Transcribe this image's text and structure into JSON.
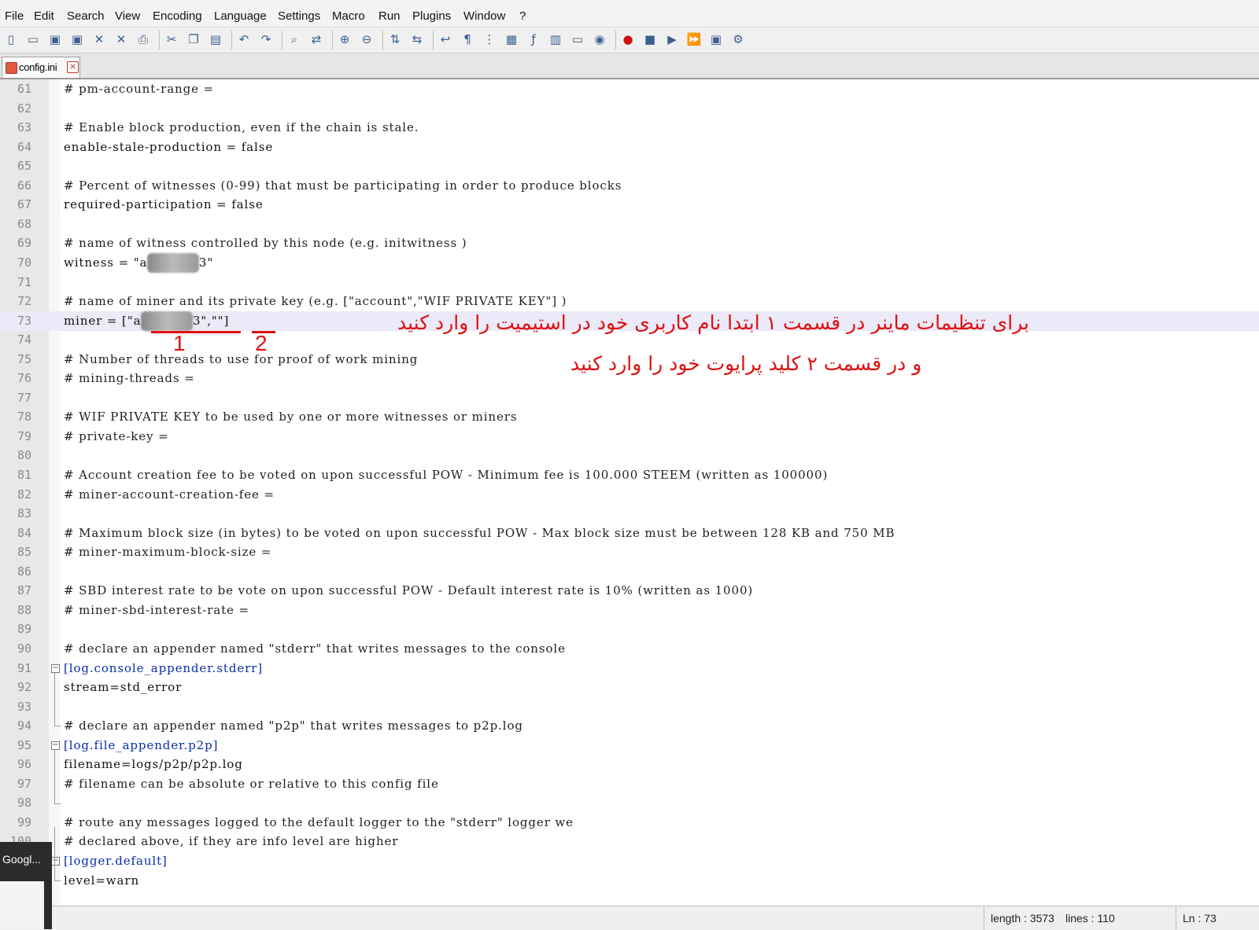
{
  "menu": [
    "File",
    "Edit",
    "Search",
    "View",
    "Encoding",
    "Language",
    "Settings",
    "Macro",
    "Run",
    "Plugins",
    "Window",
    "?"
  ],
  "toolbar_icons": [
    "new-file-icon",
    "open-file-icon",
    "save-icon",
    "save-all-icon",
    "close-icon",
    "close-all-icon",
    "print-icon",
    "cut-icon",
    "copy-icon",
    "paste-icon",
    "undo-icon",
    "redo-icon",
    "find-icon",
    "replace-icon",
    "zoom-in-icon",
    "zoom-out-icon",
    "sync-vertical-icon",
    "sync-horizontal-icon",
    "word-wrap-icon",
    "show-all-chars-icon",
    "indent-guide-icon",
    "doc-map-icon",
    "function-list-icon",
    "folder-workspace-icon",
    "monitor-icon",
    "eye-icon",
    "record-macro-icon",
    "stop-macro-icon",
    "play-macro-icon",
    "run-macro-multiple-icon",
    "save-macro-icon",
    "plugin-icon"
  ],
  "tab": {
    "label": "config.ini"
  },
  "editor": {
    "lines": [
      {
        "n": "61",
        "text": "# pm-account-range =",
        "kind": "comment"
      },
      {
        "n": "62",
        "text": "",
        "kind": "blank"
      },
      {
        "n": "63",
        "text": "# Enable block production, even if the chain is stale.",
        "kind": "comment"
      },
      {
        "n": "64",
        "text": "enable-stale-production = false",
        "kind": "code"
      },
      {
        "n": "65",
        "text": "",
        "kind": "blank"
      },
      {
        "n": "66",
        "text": "# Percent of witnesses (0-99) that must be participating in order to produce blocks",
        "kind": "comment"
      },
      {
        "n": "67",
        "text": "required-participation = false",
        "kind": "code"
      },
      {
        "n": "68",
        "text": "",
        "kind": "blank"
      },
      {
        "n": "69",
        "text": "# name of witness controlled by this node (e.g. initwitness )",
        "kind": "comment"
      },
      {
        "n": "70",
        "text": "witness = \"a▇▇▇▇▇▇▇3\"",
        "kind": "code"
      },
      {
        "n": "71",
        "text": "",
        "kind": "blank"
      },
      {
        "n": "72",
        "text": "# name of miner and its private key (e.g. [\"account\",\"WIF PRIVATE KEY\"] )",
        "kind": "comment"
      },
      {
        "n": "73",
        "text": "miner = [\"a▇▇▇▇▇▇▇3\",\"\"]",
        "kind": "code"
      },
      {
        "n": "74",
        "text": "",
        "kind": "blank"
      },
      {
        "n": "75",
        "text": "# Number of threads to use for proof of work mining",
        "kind": "comment"
      },
      {
        "n": "76",
        "text": "# mining-threads =",
        "kind": "comment"
      },
      {
        "n": "77",
        "text": "",
        "kind": "blank"
      },
      {
        "n": "78",
        "text": "# WIF PRIVATE KEY to be used by one or more witnesses or miners",
        "kind": "comment"
      },
      {
        "n": "79",
        "text": "# private-key =",
        "kind": "comment"
      },
      {
        "n": "80",
        "text": "",
        "kind": "blank"
      },
      {
        "n": "81",
        "text": "# Account creation fee to be voted on upon successful POW - Minimum fee is 100.000 STEEM (written as 100000)",
        "kind": "comment"
      },
      {
        "n": "82",
        "text": "# miner-account-creation-fee =",
        "kind": "comment"
      },
      {
        "n": "83",
        "text": "",
        "kind": "blank"
      },
      {
        "n": "84",
        "text": "# Maximum block size (in bytes) to be voted on upon successful POW - Max block size must be between 128 KB and 750 MB",
        "kind": "comment"
      },
      {
        "n": "85",
        "text": "# miner-maximum-block-size =",
        "kind": "comment"
      },
      {
        "n": "86",
        "text": "",
        "kind": "blank"
      },
      {
        "n": "87",
        "text": "# SBD interest rate to be vote on upon successful POW - Default interest rate is 10% (written as 1000)",
        "kind": "comment"
      },
      {
        "n": "88",
        "text": "# miner-sbd-interest-rate =",
        "kind": "comment"
      },
      {
        "n": "89",
        "text": "",
        "kind": "blank"
      },
      {
        "n": "90",
        "text": "# declare an appender named \"stderr\" that writes messages to the console",
        "kind": "comment"
      },
      {
        "n": "91",
        "text": "[log.console_appender.stderr]",
        "kind": "section"
      },
      {
        "n": "92",
        "text": "stream=std_error",
        "kind": "code"
      },
      {
        "n": "93",
        "text": "",
        "kind": "blank"
      },
      {
        "n": "94",
        "text": "# declare an appender named \"p2p\" that writes messages to p2p.log",
        "kind": "comment"
      },
      {
        "n": "95",
        "text": "[log.file_appender.p2p]",
        "kind": "section"
      },
      {
        "n": "96",
        "text": "filename=logs/p2p/p2p.log",
        "kind": "code"
      },
      {
        "n": "97",
        "text": "# filename can be absolute or relative to this config file",
        "kind": "comment"
      },
      {
        "n": "98",
        "text": "",
        "kind": "blank"
      },
      {
        "n": "99",
        "text": "# route any messages logged to the default logger to the \"stderr\" logger we",
        "kind": "comment"
      },
      {
        "n": "100",
        "text": "# declared above, if they are info level are higher",
        "kind": "comment"
      },
      {
        "n": "101",
        "text": "[logger.default]",
        "kind": "section"
      },
      {
        "n": "102",
        "text": "level=warn",
        "kind": "code"
      }
    ]
  },
  "annotation": {
    "line1": "برای تنظیمات ماینر در قسمت ۱  ابتدا  نام کاربری خود در استیمیت را وارد کنید",
    "line2": "و در قسمت ۲ کلید پرایوت خود را وارد کنید",
    "mark1": "1",
    "mark2": "2",
    "color": "#e01010"
  },
  "status": {
    "length": "length : 3573",
    "lines": "lines : 110",
    "position": "Ln : 73"
  },
  "taskbar": {
    "label": "Googl..."
  }
}
